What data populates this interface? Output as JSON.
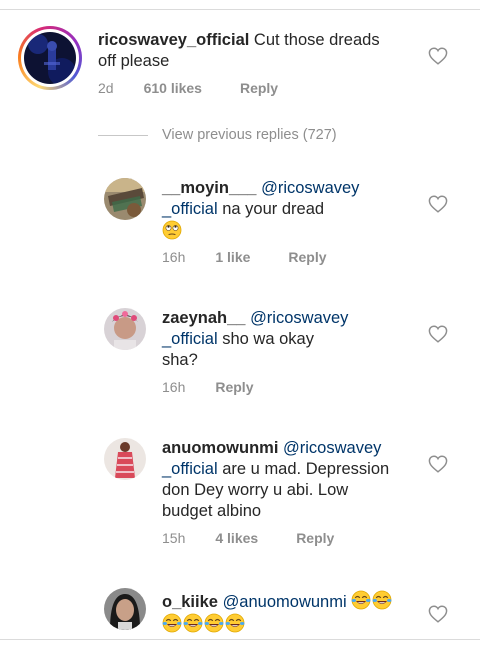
{
  "main_comment": {
    "username": "ricoswavey_official",
    "text_line1": "Cut those dreads",
    "text_line2": "off please",
    "time": "2d",
    "likes": "610 likes",
    "reply_label": "Reply"
  },
  "view_previous": "View previous replies (727)",
  "replies": [
    {
      "username": "__moyin___",
      "mention_part1": "@ricoswavey",
      "mention_part2": "_official",
      "text": "na your dread",
      "emoji": "face-with-rolling-eyes",
      "time": "16h",
      "likes": "1 like",
      "reply_label": "Reply"
    },
    {
      "username": "zaeynah__",
      "mention_part1": "@ricoswavey",
      "mention_part2": "_official",
      "text_line1": "sho wa okay",
      "text_line2": "sha?",
      "time": "16h",
      "reply_label": "Reply"
    },
    {
      "username": "anuomowunmi",
      "mention_part1": "@ricoswavey",
      "mention_part2": "_official",
      "text_line1": "are u mad. Depression",
      "text_line2": "don Dey worry u abi. Low",
      "text_line3": "budget albino",
      "time": "15h",
      "likes": "4 likes",
      "reply_label": "Reply"
    },
    {
      "username": "o_kiike",
      "mention": "@anuomowunmi",
      "emoji": "face-with-tears-of-joy",
      "emoji_count": 6
    }
  ],
  "icons": {
    "like": "heart-outline-icon",
    "heart_color": "#8e8e8e",
    "mention_color": "#003569"
  }
}
